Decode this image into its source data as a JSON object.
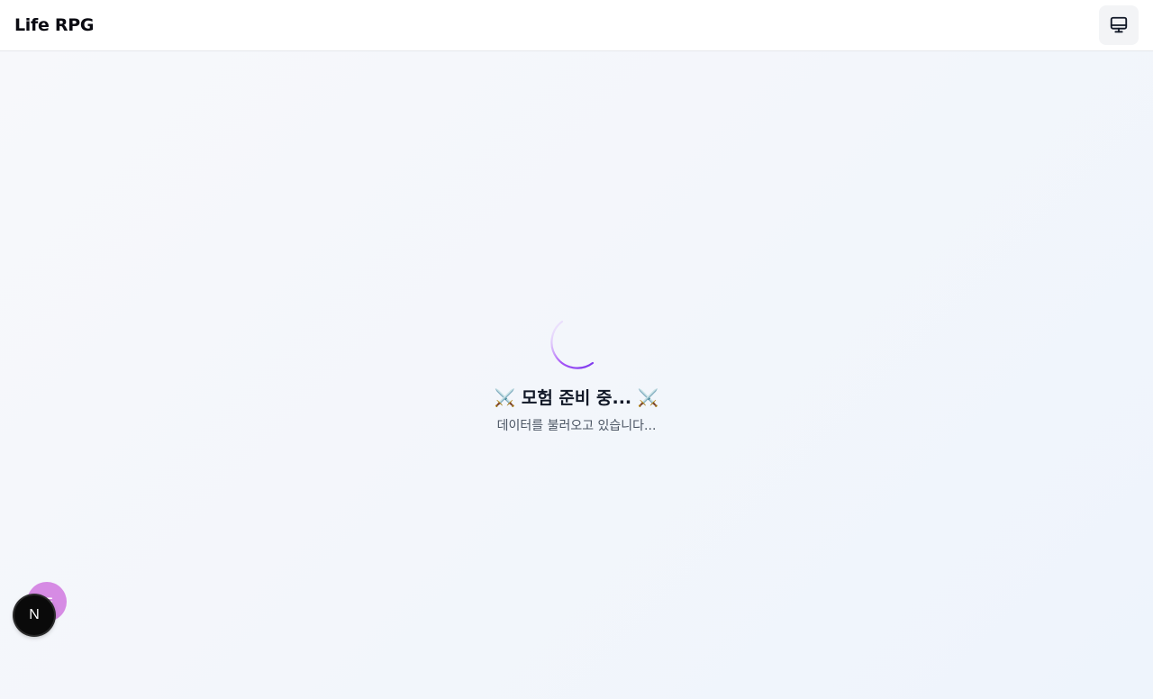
{
  "header": {
    "app_title": "Life RPG",
    "display_button_icon": "monitor-icon"
  },
  "loading": {
    "title": "⚔️ 모험 준비 중... ⚔️",
    "subtitle": "데이터를 불러오고 있습니다...",
    "spinner_colors": [
      "#7c3aed",
      "#c084fc"
    ]
  },
  "floating": {
    "menu_button_icon": "menu-icon",
    "menu_button_color": "#d68be4",
    "dev_badge_letter": "N"
  }
}
